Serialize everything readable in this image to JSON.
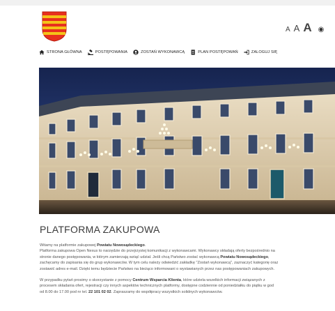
{
  "header": {
    "font_size_small": "A",
    "font_size_medium": "A",
    "font_size_large": "A",
    "contrast_icon": "eye-icon"
  },
  "nav": {
    "items": [
      {
        "label": "STRONA GŁÓWNA",
        "icon": "home-icon"
      },
      {
        "label": "POSTĘPOWANIA",
        "icon": "gavel-icon"
      },
      {
        "label": "ZOSTAŃ WYKONAWCĄ",
        "icon": "user-icon"
      },
      {
        "label": "PLAN POSTĘPOWAŃ",
        "icon": "document-icon"
      },
      {
        "label": "ZALOGUJ SIĘ",
        "icon": "login-icon"
      }
    ]
  },
  "page": {
    "title": "PLATFORMA ZAKUPOWA"
  },
  "paragraph1": {
    "l1a": "Witamy na platformie zakupowej ",
    "l1b": "Powiatu Nowosądeckiego",
    "l1c": ".",
    "l2": "Platforma zakupowa Open Nexus to narzędzie do przejrzystej komunikacji z wykonawcami. Wykonawcy składają oferty bezpośrednio na",
    "l3a": "stronie danego postępowania, w którym zamierzają wziąć udział. Jeśli chcą Państwo zostać wykonawcą ",
    "l3b": "Powiatu Nowosądeckiego",
    "l3c": ",",
    "l4": "zachęcamy do zapisania się do grup wykonawców. W tym celu należy odwiedzić zakładkę \"Zostań wykonawcą\", zaznaczyć kategorię oraz",
    "l5": "zostawić adres e-mail. Dzięki temu będziecie Państwo na bieżąco informowani o wystawianych przez nas postępowaniach zakupowych."
  },
  "paragraph2": {
    "l1a": "W przypadku pytań prosimy o skorzystanie z pomocy ",
    "l1b": "Centrum Wsparcia Klienta",
    "l1c": ", które udziela wszelkich informacji związanych z",
    "l2": "procesem składania ofert, rejestracji czy innych aspektów technicznych platformy, dostępne codziennie od poniedziałku do piątku w god",
    "l3a": "od 8.00 do 17.00 pod nr tel. ",
    "l3b": "22 101 02 02",
    "l3c": ". Zapraszamy do współpracy wszystkich solidnych wykonawców."
  }
}
